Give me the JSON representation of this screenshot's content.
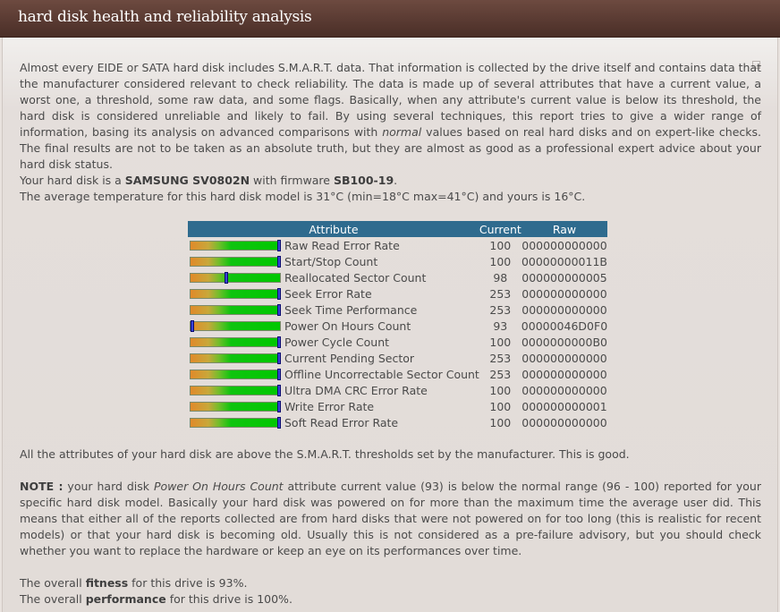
{
  "title": "hard disk health and reliability analysis",
  "intro": {
    "part1": "Almost every EIDE or SATA hard disk includes S.M.A.R.T. data. That information is collected by the drive itself and contains data that the manufacturer considered relevant to check reliability. The data is made up of several attributes that have a current value, a worst one, a threshold, some raw data, and some flags. Basically, when any attribute's current value is below its threshold, the hard disk is considered unreliable and likely to fail. By using several techniques, this report tries to give a wider range of information, basing its analysis on advanced comparisons with ",
    "emph": "normal",
    "part2": " values based on real hard disks and on expert-like checks. The final results are not to be taken as an absolute truth, but they are almost as good as a professional expert advice about your hard disk status."
  },
  "disk": {
    "prefix": "Your hard disk is a ",
    "model": "SAMSUNG SV0802N",
    "firmware_prefix": " with firmware ",
    "firmware": "SB100-19",
    "suffix": ".",
    "temperature": "The average temperature for this hard disk model is 31°C (min=18°C max=41°C) and yours is 16°C."
  },
  "table": {
    "headers": {
      "attribute": "Attribute",
      "current": "Current",
      "raw": "Raw"
    },
    "rows": [
      {
        "name": "Raw Read Error Rate",
        "current": "100",
        "raw": "000000000000",
        "level": 1.0
      },
      {
        "name": "Start/Stop Count",
        "current": "100",
        "raw": "00000000011B",
        "level": 1.0
      },
      {
        "name": "Reallocated Sector Count",
        "current": "98",
        "raw": "000000000005",
        "level": 0.4
      },
      {
        "name": "Seek Error Rate",
        "current": "253",
        "raw": "000000000000",
        "level": 1.0
      },
      {
        "name": "Seek Time Performance",
        "current": "253",
        "raw": "000000000000",
        "level": 1.0
      },
      {
        "name": "Power On Hours Count",
        "current": "93",
        "raw": "00000046D0F0",
        "level": 0.0
      },
      {
        "name": "Power Cycle Count",
        "current": "100",
        "raw": "0000000000B0",
        "level": 1.0
      },
      {
        "name": "Current Pending Sector",
        "current": "253",
        "raw": "000000000000",
        "level": 1.0
      },
      {
        "name": "Offline Uncorrectable Sector Count",
        "current": "253",
        "raw": "000000000000",
        "level": 1.0
      },
      {
        "name": "Ultra DMA CRC Error Rate",
        "current": "100",
        "raw": "000000000000",
        "level": 1.0
      },
      {
        "name": "Write Error Rate",
        "current": "100",
        "raw": "000000000001",
        "level": 1.0
      },
      {
        "name": "Soft Read Error Rate",
        "current": "100",
        "raw": "000000000000",
        "level": 1.0
      }
    ]
  },
  "good": "All the attributes of your hard disk are above the S.M.A.R.T. thresholds set by the manufacturer. This is good.",
  "note": {
    "label": "NOTE :",
    "part1": " your hard disk ",
    "emph": "Power On Hours Count",
    "part2": " attribute current value (93) is below the normal range (96 - 100) reported for your specific hard disk model. Basically your hard disk was powered on for more than the maximum time the average user did. This means that either all of the reports collected are from hard disks that were not powered on for too long (this is realistic for recent models) or that your hard disk is becoming old. Usually this is not considered as a pre-failure advisory, but you should check whether you want to replace the hardware or keep an eye on its performances over time."
  },
  "fitness": {
    "prefix": "The overall ",
    "label": "fitness",
    "suffix": " for this drive is 93%."
  },
  "performance": {
    "prefix": "The overall ",
    "label": "performance",
    "suffix": " for this drive is 100%."
  },
  "colors": {
    "title_bar": "#5a3a32",
    "table_header": "#2f6b8e",
    "bar_marker": "#3a44d8"
  }
}
